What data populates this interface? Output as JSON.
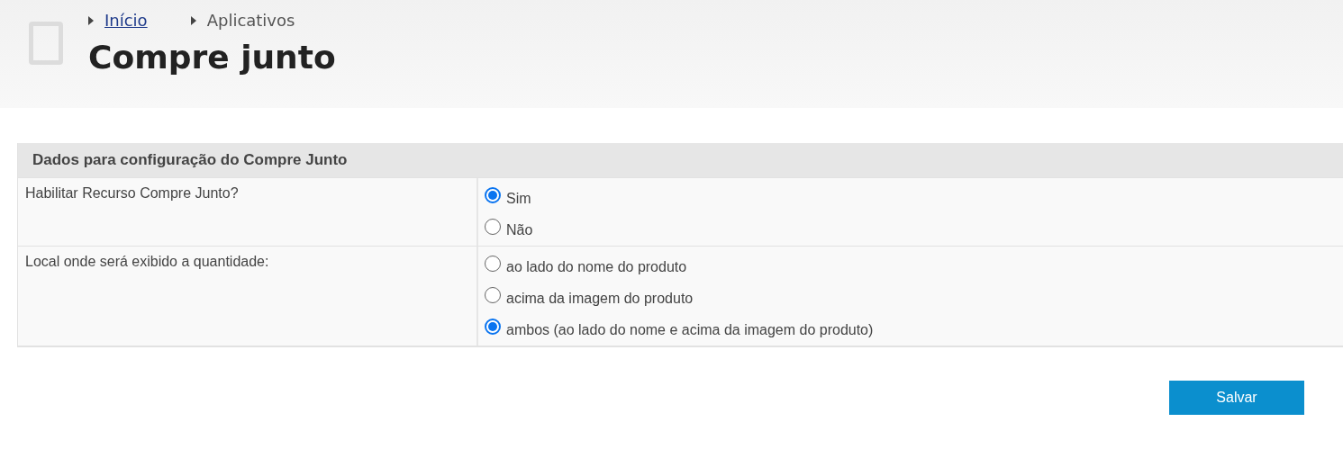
{
  "breadcrumb": [
    {
      "label": "Início",
      "link": true
    },
    {
      "label": "Aplicativos",
      "link": false
    }
  ],
  "page_title": "Compre junto",
  "form": {
    "title": "Dados para configuração do Compre Junto",
    "rows": [
      {
        "label": "Habilitar Recurso Compre Junto?",
        "options": [
          {
            "label": "Sim",
            "selected": true
          },
          {
            "label": "Não",
            "selected": false
          }
        ]
      },
      {
        "label": "Local onde será exibido a quantidade:",
        "options": [
          {
            "label": "ao lado do nome do produto",
            "selected": false
          },
          {
            "label": "acima da imagem do produto",
            "selected": false
          },
          {
            "label": "ambos (ao lado do nome e acima da imagem do produto)",
            "selected": true
          }
        ]
      }
    ]
  },
  "save_button": "Salvar"
}
